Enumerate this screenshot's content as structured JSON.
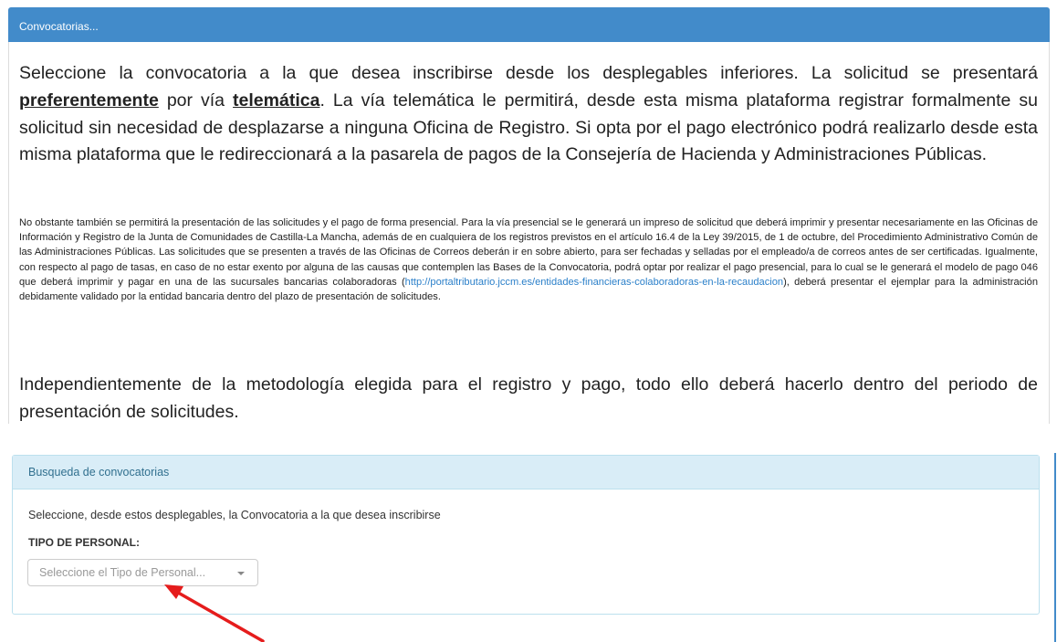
{
  "header": {
    "title": "Convocatorias..."
  },
  "intro": {
    "part1": "Seleccione la convocatoria a la que desea inscribirse desde los desplegables inferiores. La solicitud se presentará ",
    "emph1": "preferentemente",
    "part2": " por vía ",
    "emph2": "telemática",
    "part3": ". La vía telemática le permitirá, desde esta misma plataforma registrar formalmente su solicitud sin necesidad de desplazarse a ninguna Oficina de Registro. Si opta por el pago electrónico podrá realizarlo desde esta misma plataforma que le redireccionará a la pasarela de pagos de la Consejería de Hacienda y Administraciones Públicas."
  },
  "details": {
    "part1": "No obstante también se permitirá la presentación de las solicitudes y el pago de forma presencial. Para la vía presencial se le generará un impreso de solicitud que deberá imprimir y presentar necesariamente en las Oficinas de Información y Registro de la Junta de Comunidades de Castilla-La Mancha, además de en cualquiera de los registros previstos en el artículo 16.4 de la Ley 39/2015, de 1 de octubre, del Procedimiento Administrativo Común de las Administraciones Públicas. Las solicitudes que se presenten a través de las Oficinas de Correos deberán ir en sobre abierto, para ser fechadas y selladas por el empleado/a de correos antes de ser certificadas. Igualmente, con respecto al pago de tasas, en caso de no estar exento por alguna de las causas que contemplen las Bases de la Convocatoria, podrá optar por realizar el pago presencial, para lo cual se le generará el modelo de pago 046 que deberá imprimir y pagar en una de las sucursales bancarias colaboradoras (",
    "link": "http://portaltributario.jccm.es/entidades-financieras-colaboradoras-en-la-recaudacion",
    "part2": "), deberá presentar el ejemplar para la administración debidamente validado por la entidad bancaria dentro del plazo de presentación de solicitudes."
  },
  "closing": "Independientemente de la metodología elegida para el registro y pago, todo ello deberá hacerlo dentro del periodo de presentación de solicitudes.",
  "search": {
    "heading": "Busqueda de convocatorias",
    "hint": "Seleccione, desde estos desplegables, la Convocatoria a la que desea inscribirse",
    "tipo_label": "TIPO DE PERSONAL:",
    "tipo_placeholder": "Seleccione el Tipo de Personal..."
  },
  "colors": {
    "header_bg": "#428bca",
    "info_heading_bg": "#d9edf7",
    "link": "#2a7fc9",
    "annotation_arrow": "#e51c1c"
  },
  "icons": {
    "dropdown": "caret-down-icon",
    "annotation": "red-arrow-icon"
  }
}
